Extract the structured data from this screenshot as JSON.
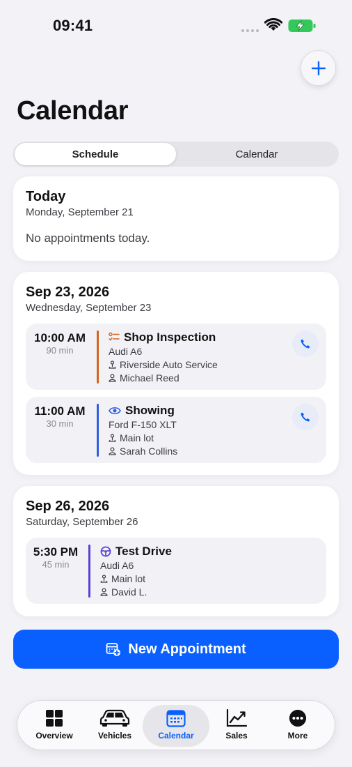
{
  "status": {
    "time": "09:41"
  },
  "header": {
    "title": "Calendar"
  },
  "segments": {
    "schedule": "Schedule",
    "calendar": "Calendar"
  },
  "days": [
    {
      "title": "Today",
      "subtitle": "Monday, September 21",
      "empty": "No appointments today."
    },
    {
      "title": "Sep 23, 2026",
      "subtitle": "Wednesday, September 23",
      "appointments": [
        {
          "time": "10:00 AM",
          "duration": "90 min",
          "type": "Shop Inspection",
          "vehicle": "Audi A6",
          "location": "Riverside Auto Service",
          "person": "Michael Reed",
          "color": "#d4621c",
          "icon": "checklist-icon"
        },
        {
          "time": "11:00 AM",
          "duration": "30 min",
          "type": "Showing",
          "vehicle": "Ford F-150 XLT",
          "location": "Main lot",
          "person": "Sarah Collins",
          "color": "#2f5ce0",
          "icon": "eye-icon"
        }
      ]
    },
    {
      "title": "Sep 26, 2026",
      "subtitle": "Saturday, September 26",
      "appointments": [
        {
          "time": "5:30 PM",
          "duration": "45 min",
          "type": "Test Drive",
          "vehicle": "Audi A6",
          "location": "Main lot",
          "person": "David L.",
          "color": "#5b3fd6",
          "icon": "steering-wheel-icon"
        }
      ]
    }
  ],
  "actions": {
    "new_appointment": "New Appointment"
  },
  "tabs": [
    {
      "label": "Overview",
      "icon": "grid-icon"
    },
    {
      "label": "Vehicles",
      "icon": "car-icon"
    },
    {
      "label": "Calendar",
      "icon": "calendar-icon",
      "active": true
    },
    {
      "label": "Sales",
      "icon": "chart-icon"
    },
    {
      "label": "More",
      "icon": "ellipsis-icon"
    }
  ],
  "colors": {
    "accent": "#0a60ff",
    "background": "#f2f2f7",
    "battery": "#34c759"
  }
}
